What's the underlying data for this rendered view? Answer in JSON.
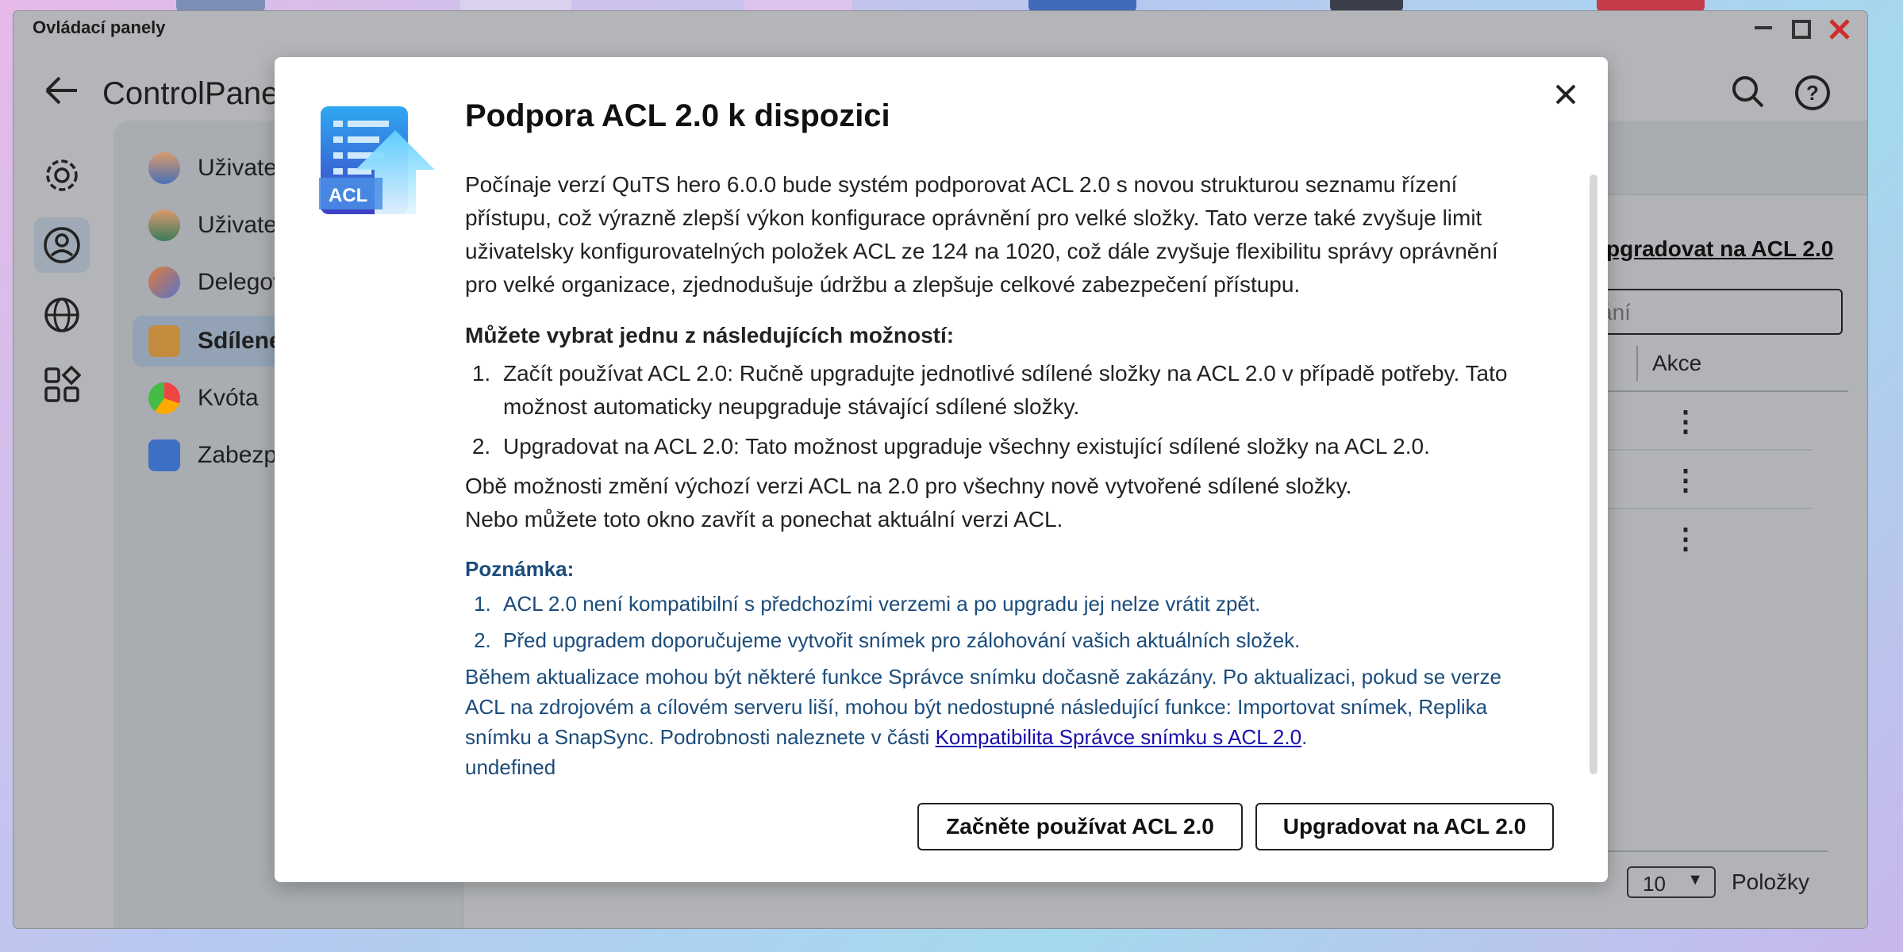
{
  "window": {
    "title": "Ovládací panely",
    "app_title": "ControlPane",
    "icons": [
      "back-arrow-icon",
      "search-icon",
      "help-icon",
      "minimize-icon",
      "maximize-icon",
      "close-icon"
    ]
  },
  "rail": {
    "items": [
      {
        "name": "settings-icon"
      },
      {
        "name": "user-icon"
      },
      {
        "name": "globe-icon"
      },
      {
        "name": "apps-icon"
      }
    ]
  },
  "sidebar": {
    "items": [
      {
        "label": "Uživatelé"
      },
      {
        "label": "Uživatels"
      },
      {
        "label": "Delegova"
      },
      {
        "label": "Sdílené s"
      },
      {
        "label": "Kvóta"
      },
      {
        "label": "Zabezpeč"
      }
    ]
  },
  "content": {
    "upgrade_link": "pgradovat na ACL 2.0",
    "search_placeholder": "ání",
    "column_akce": "Akce",
    "kebab": "⋮",
    "page_size": "10",
    "page_label": "Položky"
  },
  "modal": {
    "title": "Podpora ACL 2.0 k dispozici",
    "logo_text": "ACL",
    "intro": "Počínaje verzí QuTS hero 6.0.0 bude systém podporovat ACL 2.0 s novou strukturou seznamu řízení přístupu, což výrazně zlepší výkon konfigurace oprávnění pro velké složky. Tato verze také zvyšuje limit uživatelsky konfigurovatelných položek ACL ze 124 na 1020, což dále zvyšuje flexibilitu správy oprávnění pro velké organizace, zjednodušuje údržbu a zlepšuje celkové zabezpečení přístupu.",
    "choose_heading": "Můžete vybrat jednu z následujících možností:",
    "options": [
      "Začít používat ACL 2.0: Ručně upgradujte jednotlivé sdílené složky na ACL 2.0 v případě potřeby. Tato možnost automaticky neupgraduje stávající sdílené složky.",
      "Upgradovat na ACL 2.0: Tato možnost upgraduje všechny existující sdílené složky na ACL 2.0."
    ],
    "both_note": "Obě možnosti změní výchozí verzi ACL na 2.0 pro všechny nově vytvořené sdílené složky.",
    "or_close": "Nebo můžete toto okno zavřít a ponechat aktuální verzi ACL.",
    "note_title": "Poznámka:",
    "notes": [
      "ACL 2.0 není kompatibilní s předchozími verzemi a po upgradu jej nelze vrátit zpět.",
      "Před upgradem doporučujeme vytvořit snímek pro zálohování vašich aktuálních složek."
    ],
    "snapshot_text": "Během aktualizace mohou být některé funkce Správce snímku dočasně zakázány. Po aktualizaci, pokud se verze ACL na zdrojovém a cílovém serveru liší, mohou být nedostupné následující funkce: Importovat snímek, Replika snímku a SnapSync. Podrobnosti naleznete v části",
    "snapshot_link": "Kompatibilita Správce snímku s ACL 2.0",
    "snapshot_end": ".",
    "trailing": "undefined",
    "btn_start": "Začněte používat ACL 2.0",
    "btn_upgrade": "Upgradovat na ACL 2.0"
  }
}
